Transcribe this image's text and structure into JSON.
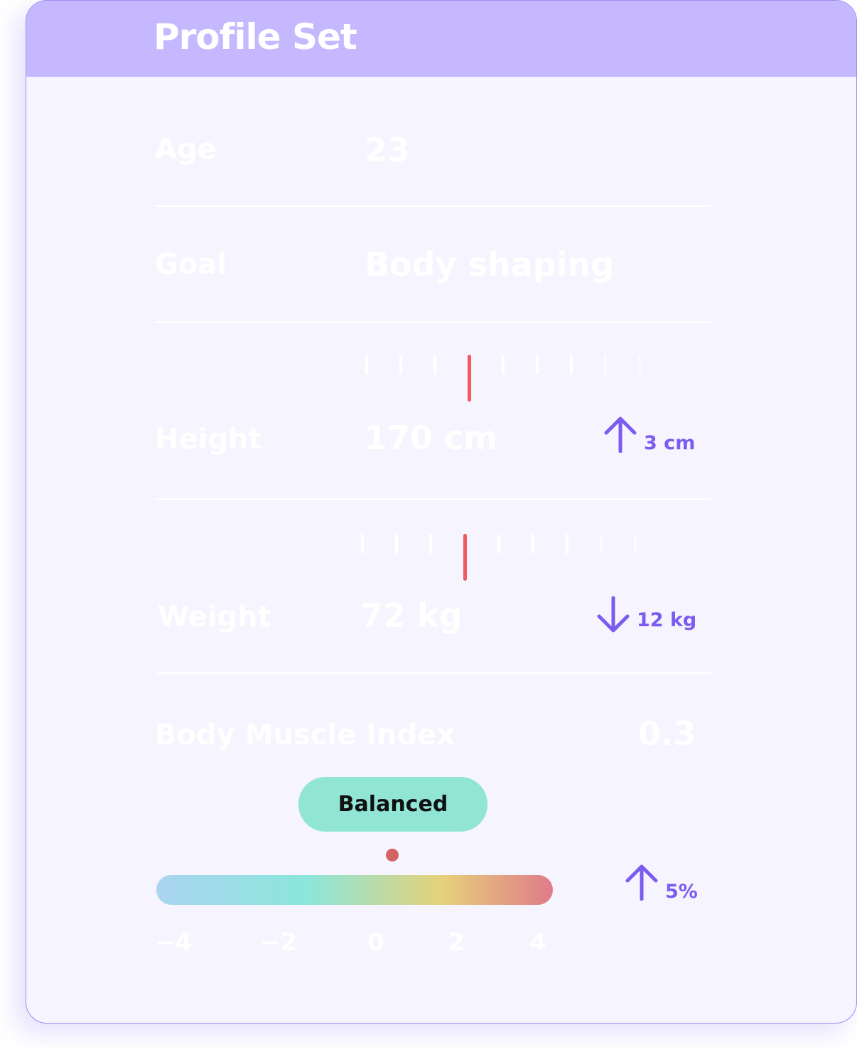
{
  "card": {
    "title": "Profile Set"
  },
  "fields": {
    "age": {
      "label": "Age",
      "value": "23"
    },
    "goal": {
      "label": "Goal",
      "value": "Body shaping"
    },
    "height": {
      "label": "Height",
      "value": "170 cm",
      "change": "3 cm",
      "change_direction": "up",
      "change_icon": "arrow-up-icon"
    },
    "weight": {
      "label": "Weight",
      "value": "72 kg",
      "change": "12 kg",
      "change_direction": "down",
      "change_icon": "arrow-down-icon"
    },
    "bmi": {
      "label": "Body Muscle Index",
      "value": "0.3",
      "status": "Balanced",
      "change": "5%",
      "change_direction": "up",
      "change_icon": "arrow-up-icon",
      "scale_ticks": [
        "−4",
        "−2",
        "0",
        "2",
        "4"
      ],
      "scale_min": -4,
      "scale_max": 4
    }
  },
  "colors": {
    "header": "#c5b8ff",
    "card_bg": "#f6f4fe",
    "accent": "#7b5bf0",
    "marker": "#f05a5a",
    "badge": "#90e5d4",
    "indicator_dot": "#d46464"
  }
}
